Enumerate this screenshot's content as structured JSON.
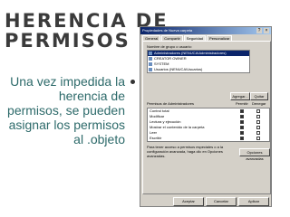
{
  "slide": {
    "title": "HERENCIA DE\nPERMISOS",
    "body": "Una vez impedida la herencia de permisos, se pueden asignar los permisos al .objeto"
  },
  "dialog": {
    "title": "Propiedades de Nueva carpeta",
    "tabs": [
      "General",
      "Compartir",
      "Seguridad",
      "Personalizar"
    ],
    "active_tab": "Seguridad",
    "names_label": "Nombre de grupo o usuario:",
    "users": [
      "Administradores (NENUCA\\Administradores)",
      "CREATOR OWNER",
      "SYSTEM",
      "Usuarios (NENUCA\\Usuarios)"
    ],
    "selected_user_index": 0,
    "add_button": "Agregar...",
    "remove_button": "Quitar",
    "permissions_label": "Permisos de Administradores",
    "allow_header": "Permitir",
    "deny_header": "Denegar",
    "permissions": [
      {
        "name": "Control total",
        "allow": true,
        "deny": false
      },
      {
        "name": "Modificar",
        "allow": true,
        "deny": false
      },
      {
        "name": "Lectura y ejecución",
        "allow": true,
        "deny": false
      },
      {
        "name": "Mostrar el contenido de la carpeta",
        "allow": true,
        "deny": false
      },
      {
        "name": "Leer",
        "allow": true,
        "deny": false
      },
      {
        "name": "Escribir",
        "allow": true,
        "deny": false
      }
    ],
    "advanced_note": "Para tener acceso a permisos especiales o a la configuración avanzada, haga clic en Opciones avanzadas.",
    "advanced_button": "Opciones avanzadas",
    "ok_button": "Aceptar",
    "cancel_button": "Cancelar",
    "apply_button": "Aplicar",
    "help_glyph": "?",
    "close_glyph": "×"
  }
}
